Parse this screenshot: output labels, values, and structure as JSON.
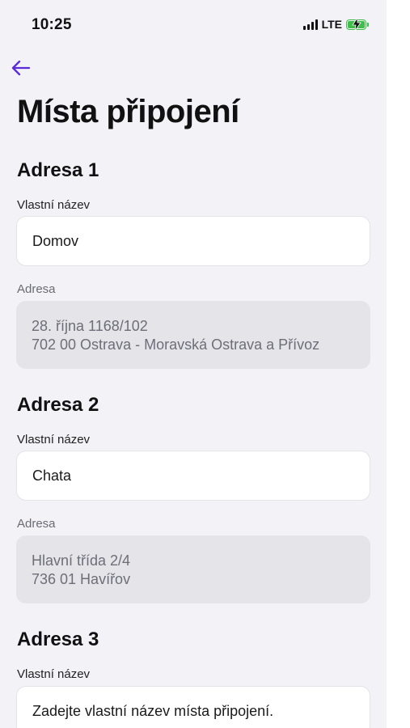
{
  "status_bar": {
    "time": "10:25",
    "network": "LTE",
    "battery_color": "#3fbf4a"
  },
  "header": {
    "back_icon": "arrow-left-icon",
    "accent_color": "#5b2bd9",
    "title": "Místa připojení"
  },
  "addresses": [
    {
      "heading": "Adresa 1",
      "name_label": "Vlastní název",
      "name_value": "Domov",
      "address_label": "Adresa",
      "address_line1": "28. října 1168/102",
      "address_line2": "702 00 Ostrava - Moravská Ostrava a Přívoz"
    },
    {
      "heading": "Adresa 2",
      "name_label": "Vlastní název",
      "name_value": "Chata",
      "address_label": "Adresa",
      "address_line1": "Hlavní třída 2/4",
      "address_line2": "736 01 Havířov"
    },
    {
      "heading": "Adresa 3",
      "name_label": "Vlastní název",
      "name_placeholder": "Zadejte vlastní název místa připojení."
    }
  ]
}
